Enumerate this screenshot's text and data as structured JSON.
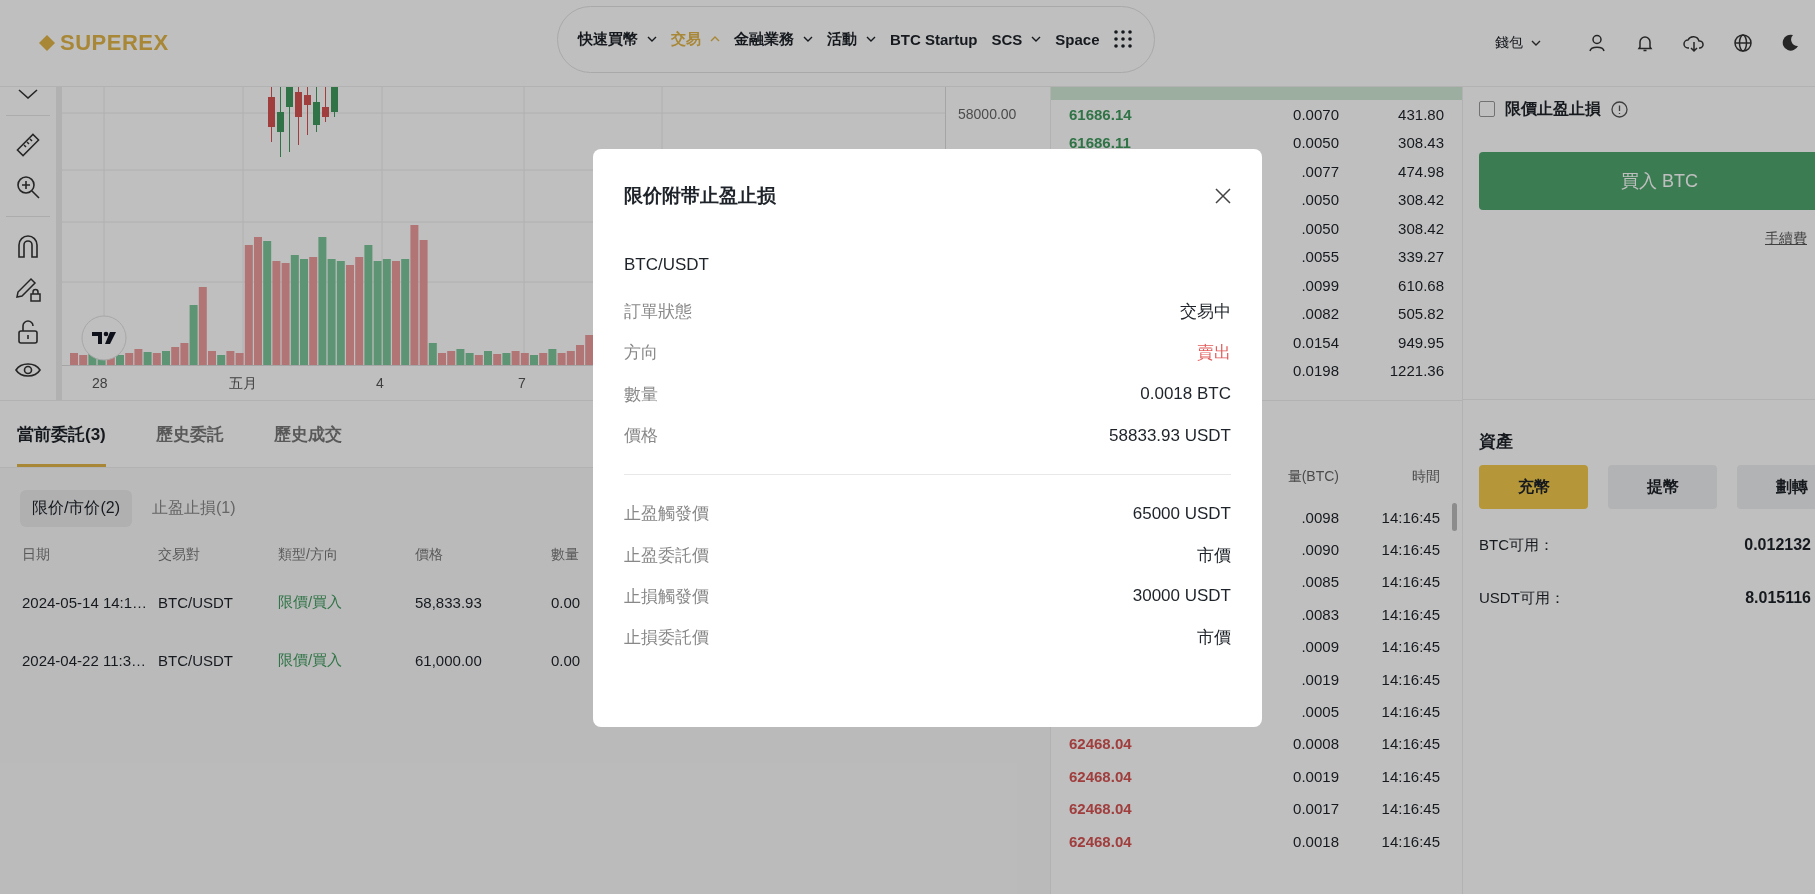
{
  "header": {
    "logo": "SUPEREX",
    "nav": [
      {
        "label": "快速買幣",
        "kind": "dropdown",
        "selected": false
      },
      {
        "label": "交易",
        "kind": "dropdown",
        "selected": true
      },
      {
        "label": "金融業務",
        "kind": "dropdown",
        "selected": false
      },
      {
        "label": "活動",
        "kind": "dropdown",
        "selected": false
      },
      {
        "label": "BTC Startup",
        "kind": "link",
        "selected": false
      },
      {
        "label": "SCS",
        "kind": "dropdown",
        "selected": false
      },
      {
        "label": "Space",
        "kind": "link",
        "selected": false
      }
    ],
    "wallet": "錢包"
  },
  "chart": {
    "price_label": "58000.00",
    "x_labels": [
      "28",
      "五月",
      "4",
      "7"
    ]
  },
  "order_book": {
    "rows": [
      {
        "price": "61686.14",
        "amount": "0.0070",
        "total": "431.80"
      },
      {
        "price": "61686.11",
        "amount": "0.0050",
        "total": "308.43"
      },
      {
        "amount": ".0077",
        "total": "474.98"
      },
      {
        "amount": ".0050",
        "total": "308.42"
      },
      {
        "amount": ".0050",
        "total": "308.42"
      },
      {
        "amount": ".0055",
        "total": "339.27"
      },
      {
        "amount": ".0099",
        "total": "610.68"
      },
      {
        "amount": ".0082",
        "total": "505.82"
      },
      {
        "amount": "0.0154",
        "total": "949.95"
      },
      {
        "amount": "0.0198",
        "total": "1221.36"
      }
    ]
  },
  "trades": {
    "columns": [
      "量(BTC)",
      "時間"
    ],
    "rows": [
      {
        "amount": ".0098",
        "time": "14:16:45"
      },
      {
        "amount": ".0090",
        "time": "14:16:45"
      },
      {
        "amount": ".0085",
        "time": "14:16:45"
      },
      {
        "amount": ".0083",
        "time": "14:16:45"
      },
      {
        "amount": ".0009",
        "time": "14:16:45"
      },
      {
        "amount": ".0019",
        "time": "14:16:45"
      },
      {
        "amount": ".0005",
        "time": "14:16:45"
      },
      {
        "price": "62468.04",
        "amount": "0.0008",
        "time": "14:16:45"
      },
      {
        "price": "62468.04",
        "amount": "0.0019",
        "time": "14:16:45"
      },
      {
        "price": "62468.04",
        "amount": "0.0017",
        "time": "14:16:45"
      },
      {
        "price": "62468.04",
        "amount": "0.0018",
        "time": "14:16:45"
      }
    ]
  },
  "order_panel": {
    "tp_sl": {
      "label": "限價止盈止損",
      "checked": false
    },
    "buy_button": "買入 BTC",
    "fee_link": "手續費"
  },
  "assets": {
    "title": "資產",
    "buttons": [
      {
        "label": "充幣",
        "kind": "primary"
      },
      {
        "label": "提幣",
        "kind": "secondary"
      },
      {
        "label": "劃轉",
        "kind": "secondary"
      }
    ],
    "balances": [
      {
        "label": "BTC可用：",
        "value": "0.012132"
      },
      {
        "label": "USDT可用：",
        "value": "8.015116"
      }
    ]
  },
  "orders": {
    "tabs": [
      {
        "label": "當前委託(3)",
        "selected": true
      },
      {
        "label": "歷史委託",
        "selected": false
      },
      {
        "label": "歷史成交",
        "selected": false
      }
    ],
    "subtabs": [
      {
        "label": "限价/市价(2)",
        "selected": true
      },
      {
        "label": "止盈止損(1)",
        "selected": false
      }
    ],
    "columns": [
      "日期",
      "交易對",
      "類型/方向",
      "價格",
      "數量"
    ],
    "rows": [
      {
        "date": "2024-05-14 14:1…",
        "pair": "BTC/USDT",
        "type": "限價/買入",
        "price": "58,833.93",
        "amount": "0.00"
      },
      {
        "date": "2024-04-22 11:3…",
        "pair": "BTC/USDT",
        "type": "限價/買入",
        "price": "61,000.00",
        "amount": "0.00"
      }
    ]
  },
  "modal": {
    "title": "限价附带止盈止损",
    "pair": "BTC/USDT",
    "details": [
      {
        "label": "訂單狀態",
        "value": "交易中",
        "negative": false
      },
      {
        "label": "方向",
        "value": "賣出",
        "negative": true
      },
      {
        "label": "數量",
        "value": "0.0018 BTC",
        "negative": false
      },
      {
        "label": "價格",
        "value": "58833.93 USDT",
        "negative": false
      }
    ],
    "triggers": [
      {
        "label": "止盈觸發價",
        "value": "65000 USDT"
      },
      {
        "label": "止盈委託價",
        "value": "市價"
      },
      {
        "label": "止損觸發價",
        "value": "30000 USDT"
      },
      {
        "label": "止損委託價",
        "value": "市價"
      }
    ]
  }
}
